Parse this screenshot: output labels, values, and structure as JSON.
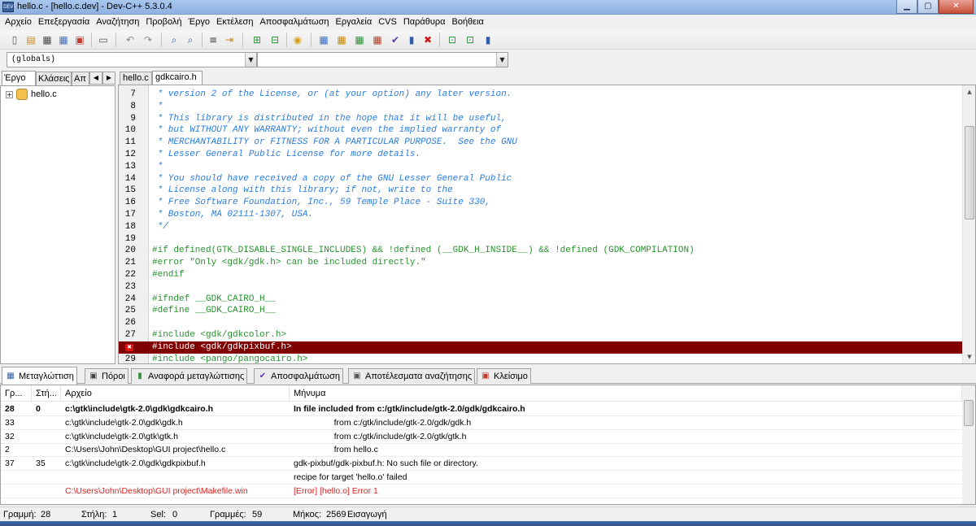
{
  "window": {
    "title": "hello.c - [hello.c.dev] - Dev-C++ 5.3.0.4",
    "app_icon_label": "DEV",
    "minimize": "▁",
    "maximize": "▢",
    "close": "✕"
  },
  "menu": [
    "Αρχείο",
    "Επεξεργασία",
    "Αναζήτηση",
    "Προβολή",
    "Έργο",
    "Εκτέλεση",
    "Αποσφαλμάτωση",
    "Εργαλεία",
    "CVS",
    "Παράθυρα",
    "Βοήθεια"
  ],
  "toolbar": {
    "buttons": [
      {
        "name": "new-file-icon",
        "glyph": "▯",
        "color": "#5a5a5a"
      },
      {
        "name": "open-file-icon",
        "glyph": "▤",
        "color": "#c48a1e"
      },
      {
        "name": "save-icon",
        "glyph": "▦",
        "color": "#4a4a4a"
      },
      {
        "name": "save-all-icon",
        "glyph": "▦",
        "color": "#4a6fb0"
      },
      {
        "name": "close-file-icon",
        "glyph": "▣",
        "color": "#c0392b"
      },
      {
        "name": "print-icon",
        "glyph": "▭",
        "color": "#555555"
      },
      {
        "name": "undo-icon",
        "glyph": "↶",
        "color": "#8a8a8a"
      },
      {
        "name": "redo-icon",
        "glyph": "↷",
        "color": "#8a8a8a"
      },
      {
        "name": "find-icon",
        "glyph": "⌕",
        "color": "#2f5fa8"
      },
      {
        "name": "replace-icon",
        "glyph": "⌕",
        "color": "#2f5fa8"
      },
      {
        "name": "indent-icon",
        "glyph": "≡",
        "color": "#3a3a3a"
      },
      {
        "name": "goto-line-icon",
        "glyph": "⇥",
        "color": "#c48a1e"
      },
      {
        "name": "add-to-project-icon",
        "glyph": "⊞",
        "color": "#2f8f3a"
      },
      {
        "name": "remove-from-project-icon",
        "glyph": "⊟",
        "color": "#2f8f3a"
      },
      {
        "name": "project-options-icon",
        "glyph": "◉",
        "color": "#d9a015"
      },
      {
        "name": "compile-icon",
        "glyph": "▦",
        "color": "#3a6fc0"
      },
      {
        "name": "run-icon",
        "glyph": "▦",
        "color": "#c88a10"
      },
      {
        "name": "compile-run-icon",
        "glyph": "▦",
        "color": "#2f8f3a"
      },
      {
        "name": "rebuild-icon",
        "glyph": "▦",
        "color": "#b0402a"
      },
      {
        "name": "check-syntax-icon",
        "glyph": "✔",
        "color": "#5a3aa8"
      },
      {
        "name": "profile-icon",
        "glyph": "▮",
        "color": "#2f5fa8"
      },
      {
        "name": "stop-icon",
        "glyph": "✖",
        "color": "#d01818"
      },
      {
        "name": "new-class-icon",
        "glyph": "⊡",
        "color": "#2f8f3a"
      },
      {
        "name": "new-member-icon",
        "glyph": "⊡",
        "color": "#2f8f3a"
      },
      {
        "name": "help-icon",
        "glyph": "▮",
        "color": "#2f5fa8"
      }
    ]
  },
  "combos": {
    "scope": "(globals)",
    "members": "",
    "arrow": "▼"
  },
  "left_pane": {
    "tabs": [
      "Έργο",
      "Κλάσεις",
      "Απ"
    ],
    "arrow_left": "◀",
    "arrow_right": "▶",
    "tree_expand": "+",
    "tree_item": "hello.c"
  },
  "editor": {
    "tabs": [
      "hello.c",
      "gdkcairo.h"
    ],
    "lines": [
      {
        "num": "7",
        "text": " * version 2 of the License, or (at your option) any later version.",
        "kind": "comment"
      },
      {
        "num": "8",
        "text": " *",
        "kind": "comment"
      },
      {
        "num": "9",
        "text": " * This library is distributed in the hope that it will be useful,",
        "kind": "comment"
      },
      {
        "num": "10",
        "text": " * but WITHOUT ANY WARRANTY; without even the implied warranty of",
        "kind": "comment"
      },
      {
        "num": "11",
        "text": " * MERCHANTABILITY or FITNESS FOR A PARTICULAR PURPOSE.  See the GNU",
        "kind": "comment"
      },
      {
        "num": "12",
        "text": " * Lesser General Public License for more details.",
        "kind": "comment"
      },
      {
        "num": "13",
        "text": " *",
        "kind": "comment"
      },
      {
        "num": "14",
        "text": " * You should have received a copy of the GNU Lesser General Public",
        "kind": "comment"
      },
      {
        "num": "15",
        "text": " * License along with this library; if not, write to the",
        "kind": "comment"
      },
      {
        "num": "16",
        "text": " * Free Software Foundation, Inc., 59 Temple Place - Suite 330,",
        "kind": "comment"
      },
      {
        "num": "17",
        "text": " * Boston, MA 02111-1307, USA.",
        "kind": "comment"
      },
      {
        "num": "18",
        "text": " */",
        "kind": "comment"
      },
      {
        "num": "19",
        "text": "",
        "kind": "plain"
      },
      {
        "num": "20",
        "text": "#if defined(GTK_DISABLE_SINGLE_INCLUDES) && !defined (__GDK_H_INSIDE__) && !defined (GDK_COMPILATION)",
        "kind": "pre"
      },
      {
        "num": "21",
        "text": "#error \"Only <gdk/gdk.h> can be included directly.\"",
        "kind": "pre"
      },
      {
        "num": "22",
        "text": "#endif",
        "kind": "pre"
      },
      {
        "num": "23",
        "text": "",
        "kind": "plain"
      },
      {
        "num": "24",
        "text": "#ifndef __GDK_CAIRO_H__",
        "kind": "pre"
      },
      {
        "num": "25",
        "text": "#define __GDK_CAIRO_H__",
        "kind": "pre"
      },
      {
        "num": "26",
        "text": "",
        "kind": "plain"
      },
      {
        "num": "27",
        "text": "#include <gdk/gdkcolor.h>",
        "kind": "pre"
      },
      {
        "num": "28",
        "text": "#include <gdk/gdkpixbuf.h>",
        "kind": "err"
      },
      {
        "num": "29",
        "text": "#include <pango/pangocairo.h>",
        "kind": "pre"
      }
    ],
    "error_marker": "✖",
    "scroll_up": "▲",
    "scroll_down": "▼"
  },
  "bottom_tabs": [
    {
      "label": "Μεταγλώττιση",
      "glyph": "▦",
      "color": "#2f5fa8",
      "name": "compiler-icon"
    },
    {
      "label": "Πόροι",
      "glyph": "▣",
      "color": "#444444",
      "name": "resources-icon"
    },
    {
      "label": "Αναφορά μεταγλώττισης",
      "glyph": "▮",
      "color": "#2f8f3a",
      "name": "compile-log-icon"
    },
    {
      "label": "Αποσφαλμάτωση",
      "glyph": "✔",
      "color": "#5a3aa8",
      "name": "debug-icon"
    },
    {
      "label": "Αποτέλεσματα αναζήτησης",
      "glyph": "▣",
      "color": "#555555",
      "name": "find-results-icon"
    },
    {
      "label": "Κλείσιμο",
      "glyph": "▣",
      "color": "#c0392b",
      "name": "close-panel-icon"
    }
  ],
  "messages": {
    "columns": [
      "Γρ...",
      "Στή...",
      "Αρχείο",
      "Μήνυμα"
    ],
    "rows": [
      {
        "line": "28",
        "col": "0",
        "file": "c:\\gtk\\include\\gtk-2.0\\gdk\\gdkcairo.h",
        "msg": "In file included from c:/gtk/include/gtk-2.0/gdk/gdkcairo.h",
        "style": "bold"
      },
      {
        "line": "33",
        "col": "",
        "file": "c:\\gtk\\include\\gtk-2.0\\gdk\\gdk.h",
        "msg": "                 from c:/gtk/include/gtk-2.0/gdk/gdk.h",
        "style": "normal"
      },
      {
        "line": "32",
        "col": "",
        "file": "c:\\gtk\\include\\gtk-2.0\\gtk\\gtk.h",
        "msg": "                 from c:/gtk/include/gtk-2.0/gtk/gtk.h",
        "style": "normal"
      },
      {
        "line": "2",
        "col": "",
        "file": "C:\\Users\\John\\Desktop\\GUI project\\hello.c",
        "msg": "                 from hello.c",
        "style": "normal"
      },
      {
        "line": "37",
        "col": "35",
        "file": "c:\\gtk\\include\\gtk-2.0\\gdk\\gdkpixbuf.h",
        "msg": "gdk-pixbuf/gdk-pixbuf.h: No such file or directory.",
        "style": "normal"
      },
      {
        "line": "",
        "col": "",
        "file": "",
        "msg": "recipe for target 'hello.o' failed",
        "style": "normal"
      },
      {
        "line": "",
        "col": "",
        "file": "C:\\Users\\John\\Desktop\\GUI project\\Makefile.win",
        "msg": "[Error] [hello.o] Error 1",
        "style": "red"
      }
    ]
  },
  "status": {
    "line_label": "Γραμμή:",
    "line_value": "28",
    "col_label": "Στήλη:",
    "col_value": "1",
    "sel_label": "Sel:",
    "sel_value": "0",
    "lines_label": "Γραμμές:",
    "lines_value": "59",
    "length_label": "Μήκος:",
    "length_value": "2569",
    "mode": "Εισαγωγή"
  }
}
